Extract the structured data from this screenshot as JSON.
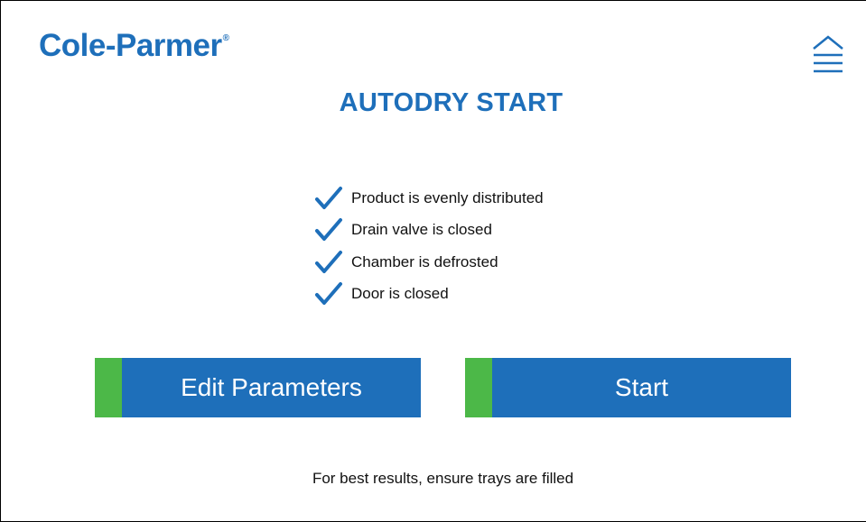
{
  "brand": {
    "name": "Cole-Parmer",
    "registered_mark": "®",
    "color": "#1e6fba"
  },
  "header": {
    "menu_icon": "home-menu-icon"
  },
  "page": {
    "title": "AUTODRY START"
  },
  "checklist": {
    "icon": "checkmark-icon",
    "items": [
      {
        "label": "Product is evenly distributed"
      },
      {
        "label": "Drain valve is closed"
      },
      {
        "label": "Chamber is defrosted"
      },
      {
        "label": "Door is closed"
      }
    ]
  },
  "actions": {
    "edit_label": "Edit Parameters",
    "start_label": "Start",
    "button_color": "#1e6fba",
    "accent_color": "#4cb848"
  },
  "footer": {
    "note": "For best results, ensure trays are filled"
  }
}
